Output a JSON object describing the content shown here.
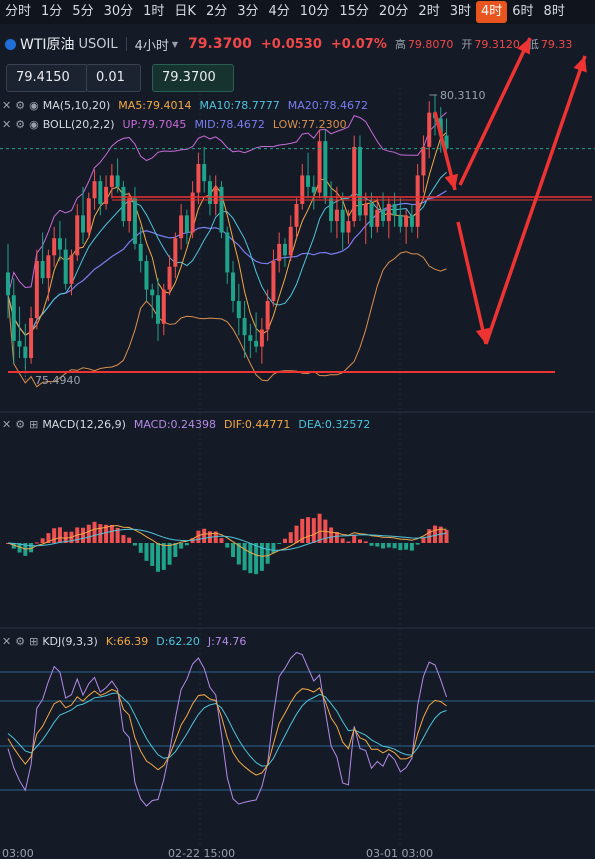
{
  "timeframes": [
    "分时",
    "1分",
    "5分",
    "30分",
    "1时",
    "日K",
    "2分",
    "3分",
    "4分",
    "10分",
    "15分",
    "20分",
    "2时",
    "3时",
    "4时",
    "6时",
    "8时"
  ],
  "active_timeframe_index": 14,
  "symbol": {
    "name": "WTI原油",
    "code": "USOIL",
    "period": "4小时",
    "price": "79.3700",
    "change": "+0.0530",
    "change_pct": "+0.07%",
    "high_label": "高",
    "high": "79.8070",
    "open_label": "开",
    "open": "79.3120",
    "low_label": "低",
    "low": "79.33"
  },
  "order_box": {
    "left": "79.4150",
    "qty": "0.01",
    "right": "79.3700"
  },
  "ma": {
    "name": "MA(5,10,20)",
    "ma5": "MA5:79.4014",
    "ma10": "MA10:78.7777",
    "ma20": "MA20:78.4672"
  },
  "boll": {
    "name": "BOLL(20,2,2)",
    "up": "UP:79.7045",
    "mid": "MID:78.4672",
    "low": "LOW:77.2300"
  },
  "price_labels": {
    "high": "80.3110",
    "low": "75.4940"
  },
  "macd": {
    "name": "MACD(12,26,9)",
    "macd": "MACD:0.24398",
    "dif": "DIF:0.44771",
    "dea": "DEA:0.32572"
  },
  "kdj": {
    "name": "KDJ(9,3,3)",
    "k": "K:66.39",
    "d": "D:62.20",
    "j": "J:74.76"
  },
  "x_labels": [
    "03:00",
    "02-22 15:00",
    "03-01 03:00"
  ],
  "colors": {
    "up": "#f0504f",
    "down": "#1fa38b",
    "ma5": "#f3a847",
    "ma10": "#4fc3dc",
    "ma20": "#7b7cf0",
    "boll_up": "#c76ad9",
    "boll_low": "#d98f4f",
    "arrow": "#ee3333",
    "accent": "#e8551e"
  },
  "chart_data": {
    "type": "candlestick",
    "candles": [
      {
        "o": 77.2,
        "h": 77.7,
        "l": 76.4,
        "c": 76.8
      },
      {
        "o": 76.8,
        "h": 77.1,
        "l": 75.6,
        "c": 76.0
      },
      {
        "o": 76.0,
        "h": 76.6,
        "l": 75.7,
        "c": 75.9
      },
      {
        "o": 75.9,
        "h": 76.3,
        "l": 75.5,
        "c": 75.7
      },
      {
        "o": 75.7,
        "h": 76.6,
        "l": 75.6,
        "c": 76.4
      },
      {
        "o": 76.4,
        "h": 77.6,
        "l": 76.2,
        "c": 77.4
      },
      {
        "o": 77.4,
        "h": 77.9,
        "l": 77.0,
        "c": 77.1
      },
      {
        "o": 77.1,
        "h": 77.6,
        "l": 76.7,
        "c": 77.5
      },
      {
        "o": 77.5,
        "h": 78.0,
        "l": 77.3,
        "c": 77.8
      },
      {
        "o": 77.8,
        "h": 78.1,
        "l": 77.4,
        "c": 77.6
      },
      {
        "o": 77.6,
        "h": 77.8,
        "l": 76.9,
        "c": 77.0
      },
      {
        "o": 77.0,
        "h": 77.6,
        "l": 76.8,
        "c": 77.5
      },
      {
        "o": 77.5,
        "h": 78.4,
        "l": 77.4,
        "c": 78.2
      },
      {
        "o": 78.2,
        "h": 78.7,
        "l": 77.7,
        "c": 77.9
      },
      {
        "o": 77.9,
        "h": 78.6,
        "l": 77.8,
        "c": 78.5
      },
      {
        "o": 78.5,
        "h": 79.0,
        "l": 78.3,
        "c": 78.8
      },
      {
        "o": 78.8,
        "h": 78.9,
        "l": 78.2,
        "c": 78.4
      },
      {
        "o": 78.4,
        "h": 78.9,
        "l": 78.3,
        "c": 78.7
      },
      {
        "o": 78.7,
        "h": 79.1,
        "l": 78.5,
        "c": 78.9
      },
      {
        "o": 78.9,
        "h": 79.2,
        "l": 78.6,
        "c": 78.7
      },
      {
        "o": 78.7,
        "h": 78.8,
        "l": 78.0,
        "c": 78.1
      },
      {
        "o": 78.1,
        "h": 78.6,
        "l": 77.9,
        "c": 78.5
      },
      {
        "o": 78.5,
        "h": 78.7,
        "l": 77.6,
        "c": 77.7
      },
      {
        "o": 77.7,
        "h": 78.0,
        "l": 77.2,
        "c": 77.4
      },
      {
        "o": 77.4,
        "h": 77.5,
        "l": 76.7,
        "c": 76.9
      },
      {
        "o": 76.9,
        "h": 77.0,
        "l": 76.4,
        "c": 76.8
      },
      {
        "o": 76.8,
        "h": 77.1,
        "l": 76.0,
        "c": 76.3
      },
      {
        "o": 76.3,
        "h": 77.0,
        "l": 76.1,
        "c": 76.9
      },
      {
        "o": 76.9,
        "h": 77.5,
        "l": 76.8,
        "c": 77.3
      },
      {
        "o": 77.3,
        "h": 77.9,
        "l": 77.1,
        "c": 77.8
      },
      {
        "o": 77.8,
        "h": 78.4,
        "l": 77.6,
        "c": 78.2
      },
      {
        "o": 78.2,
        "h": 78.3,
        "l": 77.7,
        "c": 77.9
      },
      {
        "o": 77.9,
        "h": 78.8,
        "l": 77.8,
        "c": 78.6
      },
      {
        "o": 78.6,
        "h": 79.3,
        "l": 78.4,
        "c": 79.1
      },
      {
        "o": 79.1,
        "h": 79.4,
        "l": 78.6,
        "c": 78.8
      },
      {
        "o": 78.8,
        "h": 78.9,
        "l": 78.2,
        "c": 78.4
      },
      {
        "o": 78.4,
        "h": 78.9,
        "l": 78.2,
        "c": 78.7
      },
      {
        "o": 78.7,
        "h": 78.8,
        "l": 77.8,
        "c": 77.9
      },
      {
        "o": 77.9,
        "h": 78.0,
        "l": 77.0,
        "c": 77.2
      },
      {
        "o": 77.2,
        "h": 77.4,
        "l": 76.5,
        "c": 76.7
      },
      {
        "o": 76.7,
        "h": 77.0,
        "l": 76.1,
        "c": 76.4
      },
      {
        "o": 76.4,
        "h": 76.7,
        "l": 75.7,
        "c": 76.1
      },
      {
        "o": 76.1,
        "h": 76.3,
        "l": 75.7,
        "c": 76.0
      },
      {
        "o": 76.0,
        "h": 76.5,
        "l": 75.8,
        "c": 75.9
      },
      {
        "o": 75.9,
        "h": 76.4,
        "l": 75.6,
        "c": 76.2
      },
      {
        "o": 76.2,
        "h": 76.9,
        "l": 76.0,
        "c": 76.7
      },
      {
        "o": 76.7,
        "h": 77.6,
        "l": 76.6,
        "c": 77.4
      },
      {
        "o": 77.4,
        "h": 77.9,
        "l": 77.2,
        "c": 77.7
      },
      {
        "o": 77.7,
        "h": 77.8,
        "l": 77.3,
        "c": 77.5
      },
      {
        "o": 77.5,
        "h": 78.2,
        "l": 77.4,
        "c": 78.0
      },
      {
        "o": 78.0,
        "h": 78.5,
        "l": 77.8,
        "c": 78.4
      },
      {
        "o": 78.4,
        "h": 79.1,
        "l": 78.3,
        "c": 78.9
      },
      {
        "o": 78.9,
        "h": 79.3,
        "l": 78.5,
        "c": 78.7
      },
      {
        "o": 78.7,
        "h": 78.9,
        "l": 78.3,
        "c": 78.6
      },
      {
        "o": 78.6,
        "h": 79.7,
        "l": 78.5,
        "c": 79.5
      },
      {
        "o": 79.5,
        "h": 79.7,
        "l": 78.4,
        "c": 78.5
      },
      {
        "o": 78.5,
        "h": 78.8,
        "l": 77.9,
        "c": 78.1
      },
      {
        "o": 78.1,
        "h": 78.7,
        "l": 77.8,
        "c": 78.3
      },
      {
        "o": 78.3,
        "h": 78.6,
        "l": 77.6,
        "c": 77.9
      },
      {
        "o": 77.9,
        "h": 78.3,
        "l": 77.7,
        "c": 78.1
      },
      {
        "o": 78.1,
        "h": 79.6,
        "l": 78.0,
        "c": 79.4
      },
      {
        "o": 79.4,
        "h": 79.6,
        "l": 78.1,
        "c": 78.2
      },
      {
        "o": 78.2,
        "h": 78.6,
        "l": 77.7,
        "c": 78.4
      },
      {
        "o": 78.4,
        "h": 78.6,
        "l": 77.8,
        "c": 78.0
      },
      {
        "o": 78.0,
        "h": 78.5,
        "l": 77.9,
        "c": 78.3
      },
      {
        "o": 78.3,
        "h": 78.6,
        "l": 78.0,
        "c": 78.1
      },
      {
        "o": 78.1,
        "h": 78.5,
        "l": 77.8,
        "c": 78.4
      },
      {
        "o": 78.4,
        "h": 78.6,
        "l": 78.0,
        "c": 78.2
      },
      {
        "o": 78.2,
        "h": 78.5,
        "l": 77.9,
        "c": 78.0
      },
      {
        "o": 78.0,
        "h": 78.3,
        "l": 77.7,
        "c": 78.2
      },
      {
        "o": 78.2,
        "h": 78.4,
        "l": 77.9,
        "c": 78.0
      },
      {
        "o": 78.0,
        "h": 79.1,
        "l": 77.8,
        "c": 78.9
      },
      {
        "o": 78.9,
        "h": 79.6,
        "l": 78.6,
        "c": 79.4
      },
      {
        "o": 79.4,
        "h": 80.2,
        "l": 79.2,
        "c": 80.0
      },
      {
        "o": 80.0,
        "h": 80.31,
        "l": 79.6,
        "c": 79.9
      },
      {
        "o": 79.9,
        "h": 80.1,
        "l": 79.3,
        "c": 79.6
      },
      {
        "o": 79.6,
        "h": 79.9,
        "l": 79.3,
        "c": 79.37
      }
    ]
  }
}
